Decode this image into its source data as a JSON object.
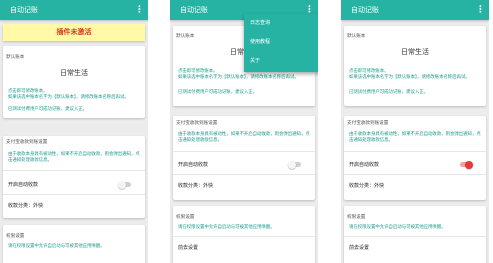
{
  "app": {
    "title": "自动记账"
  },
  "banner": {
    "text": "插件未激活"
  },
  "ledger_section": {
    "title": "默认账本",
    "ledger_name": "日常生活",
    "tips": [
      "点击即可修改账本。",
      "如果该选中账本名字为【默认账本】，请修改账本名称后再试。",
      "已测试付费用户可成功记账，建议入正。"
    ]
  },
  "alipay_section": {
    "title": "支付宝收款到账设置",
    "info": "由于收款本身具有被动性，如果不开启自动收款，则会弹出通知，点击通知处理收款信息。",
    "auto_label": "开启自动收款",
    "category_label": "收款分类：外快",
    "toggle_on_color": "#e53935",
    "toggle_off_color": "#9e9e9e"
  },
  "permission_section": {
    "title": "权限设置",
    "info": "请在权限设置中允许自启动与可被其他应用唤醒。",
    "button_label": "前去设置"
  },
  "menu": {
    "items": [
      "日志查询",
      "使用教程",
      "关于"
    ]
  },
  "colors": {
    "accent": "#27b3a4",
    "banner_bg": "#fff9a8",
    "banner_text": "#d23b1c"
  }
}
